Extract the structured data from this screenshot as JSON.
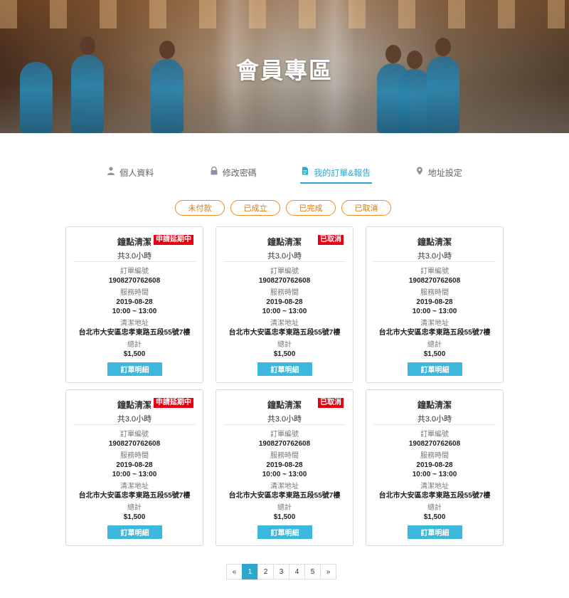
{
  "hero": {
    "title": "會員專區"
  },
  "tabs": [
    {
      "label": "個人資料",
      "icon": "user-icon"
    },
    {
      "label": "修改密碼",
      "icon": "lock-icon"
    },
    {
      "label": "我的訂單&報告",
      "icon": "document-icon",
      "active": true
    },
    {
      "label": "地址設定",
      "icon": "map-pin-icon"
    }
  ],
  "filters": [
    "未付款",
    "已成立",
    "已完成",
    "已取消"
  ],
  "orders": [
    {
      "title": "鐘點清潔",
      "hours": "共3.0小時",
      "badge": "申請延期中",
      "order_no_label": "訂單編號",
      "order_no": "1908270762608",
      "service_time_label": "服務時間",
      "service_date": "2019-08-28",
      "service_time": "10:00 ~ 13:00",
      "address_label": "清潔地址",
      "address": "台北市大安區忠孝東路五段55號7樓",
      "total_label": "總計",
      "total": "$1,500",
      "button": "訂單明細"
    },
    {
      "title": "鐘點清潔",
      "hours": "共3.0小時",
      "badge": "已取消",
      "order_no_label": "訂單編號",
      "order_no": "1908270762608",
      "service_time_label": "服務時間",
      "service_date": "2019-08-28",
      "service_time": "10:00 ~ 13:00",
      "address_label": "清潔地址",
      "address": "台北市大安區忠孝東路五段55號7樓",
      "total_label": "總計",
      "total": "$1,500",
      "button": "訂單明細"
    },
    {
      "title": "鐘點清潔",
      "hours": "共3.0小時",
      "badge": "",
      "order_no_label": "訂單編號",
      "order_no": "1908270762608",
      "service_time_label": "服務時間",
      "service_date": "2019-08-28",
      "service_time": "10:00 ~ 13:00",
      "address_label": "清潔地址",
      "address": "台北市大安區忠孝東路五段55號7樓",
      "total_label": "總計",
      "total": "$1,500",
      "button": "訂單明細"
    },
    {
      "title": "鐘點清潔",
      "hours": "共3.0小時",
      "badge": "申請延期中",
      "order_no_label": "訂單編號",
      "order_no": "1908270762608",
      "service_time_label": "服務時間",
      "service_date": "2019-08-28",
      "service_time": "10:00 ~ 13:00",
      "address_label": "清潔地址",
      "address": "台北市大安區忠孝東路五段55號7樓",
      "total_label": "總計",
      "total": "$1,500",
      "button": "訂單明細"
    },
    {
      "title": "鐘點清潔",
      "hours": "共3.0小時",
      "badge": "已取消",
      "order_no_label": "訂單編號",
      "order_no": "1908270762608",
      "service_time_label": "服務時間",
      "service_date": "2019-08-28",
      "service_time": "10:00 ~ 13:00",
      "address_label": "清潔地址",
      "address": "台北市大安區忠孝東路五段55號7樓",
      "total_label": "總計",
      "total": "$1,500",
      "button": "訂單明細"
    },
    {
      "title": "鐘點清潔",
      "hours": "共3.0小時",
      "badge": "",
      "order_no_label": "訂單編號",
      "order_no": "1908270762608",
      "service_time_label": "服務時間",
      "service_date": "2019-08-28",
      "service_time": "10:00 ~ 13:00",
      "address_label": "清潔地址",
      "address": "台北市大安區忠孝東路五段55號7樓",
      "total_label": "總計",
      "total": "$1,500",
      "button": "訂單明細"
    }
  ],
  "pagination": {
    "prev": "«",
    "next": "»",
    "pages": [
      "1",
      "2",
      "3",
      "4",
      "5"
    ],
    "current": "1"
  },
  "colors": {
    "accent": "#2fa6cc",
    "filter_border": "#f08a24",
    "badge": "#e60012",
    "button": "#3bb8dc"
  }
}
